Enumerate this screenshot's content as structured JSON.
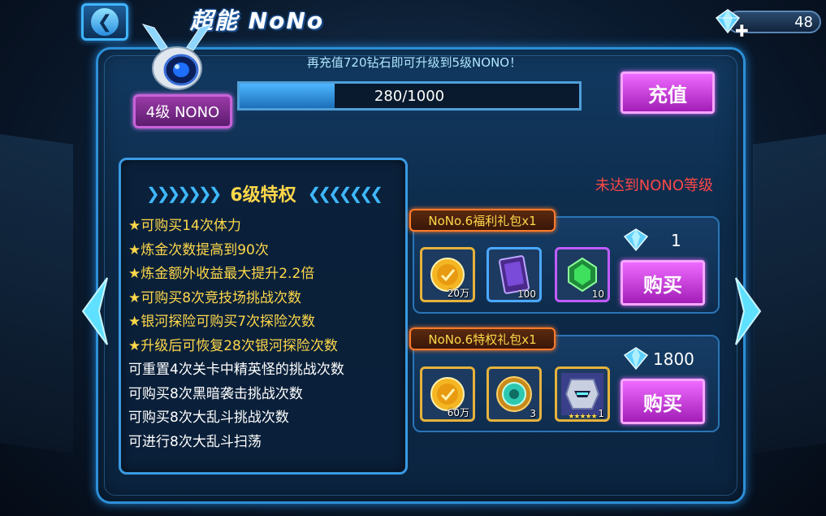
{
  "header": {
    "title": "超能 NoNo",
    "diamonds": "48",
    "back_icon": "back-arrow-icon"
  },
  "upgrade": {
    "hint": "再充值720钻石即可升级到5级NONO！",
    "level_badge": "4级 NONO",
    "progress_text": "280/1000",
    "progress_value": 280,
    "progress_max": 1000,
    "charge_label": "充值"
  },
  "privilege": {
    "title": "6级特权",
    "items": [
      "★可购买14次体力",
      "★炼金次数提高到90次",
      "★炼金额外收益最大提升2.2倍",
      "★可购买8次竞技场挑战次数",
      "★银河探险可购买7次探险次数",
      "★升级后可恢复28次银河探险次数",
      "可重置4次关卡中精英怪的挑战次数",
      "可购买8次黑暗袭击挑战次数",
      "可购买8次大乱斗挑战次数",
      "可进行8次大乱斗扫荡"
    ]
  },
  "status": {
    "not_reached": "未达到NONO等级"
  },
  "packs": [
    {
      "label": "NoNo.6福利礼包x1",
      "price": "1",
      "buy_label": "购买",
      "items": [
        {
          "icon": "gold-coin-icon",
          "qty": "20万"
        },
        {
          "icon": "purple-card-icon",
          "qty": "100"
        },
        {
          "icon": "green-crystal-icon",
          "qty": "10"
        }
      ]
    },
    {
      "label": "NoNo.6特权礼包x1",
      "price": "1800",
      "buy_label": "购买",
      "items": [
        {
          "icon": "gold-coin-icon",
          "qty": "60万"
        },
        {
          "icon": "green-orb-icon",
          "qty": "3"
        },
        {
          "icon": "robot-hero-icon",
          "qty": "1",
          "stars": "★★★★★"
        }
      ]
    }
  ],
  "colors": {
    "frame": "#2d8fd6",
    "gold": "#ffd84a",
    "warning": "#ff4747",
    "button": "#d93cf0"
  }
}
